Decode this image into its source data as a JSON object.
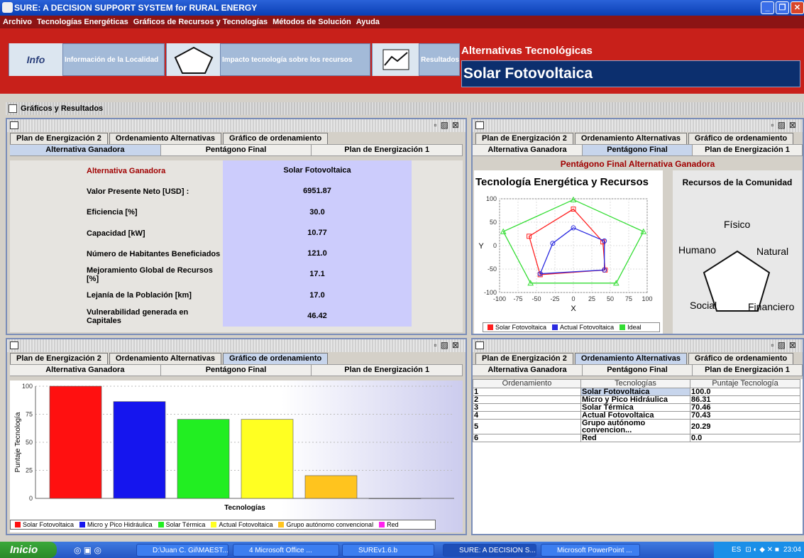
{
  "window": {
    "title": "SURE: A DECISION SUPPORT SYSTEM for RURAL ENERGY"
  },
  "menu": [
    "Archivo",
    "Tecnologías Energéticas",
    "Gráficos de Recursos y Tecnologías",
    "Métodos de Solución",
    "Ayuda"
  ],
  "toolbar": {
    "info_icon_text": "Info",
    "info_label": "Información de la Localidad",
    "impact_label": "Impacto tecnología sobre los recursos",
    "results_label": "Resultados",
    "alt_title": "Alternativas Tecnológicas",
    "alt_value": "Solar Fotovoltaica"
  },
  "section": {
    "title": "Gráficos y Resultados"
  },
  "tabs_top": [
    "Plan de Energización 2",
    "Ordenamiento Alternativas",
    "Gráfico de ordenamiento"
  ],
  "tabs_bottom": [
    "Alternativa Ganadora",
    "Pentágono Final",
    "Plan de Energización 1"
  ],
  "winner": {
    "rows": [
      {
        "label": "Alternativa Ganadora",
        "value": "Solar Fotovoltaica"
      },
      {
        "label": "Valor Presente Neto [USD] :",
        "value": "6951.87"
      },
      {
        "label": "Eficiencia [%]",
        "value": "30.0"
      },
      {
        "label": "Capacidad [kW]",
        "value": "10.77"
      },
      {
        "label": "Número de Habitantes Beneficiados",
        "value": "121.0"
      },
      {
        "label": "Mejoramiento Global de Recursos [%]",
        "value": "17.1"
      },
      {
        "label": "Lejanía de la Población [km]",
        "value": "17.0"
      },
      {
        "label": "Vulnerabilidad generada en Capitales",
        "value": "46.42"
      }
    ]
  },
  "pentagon": {
    "header": "Pentágono Final Alternativa Ganadora",
    "chart_title": "Tecnología Energética y Recursos",
    "community_title": "Recursos de la Comunidad",
    "community_labels": [
      "Físico",
      "Humano",
      "Natural",
      "Social",
      "Financiero"
    ]
  },
  "ranking": {
    "columns": [
      "Ordenamiento",
      "Tecnologías",
      "Puntaje Tecnología"
    ],
    "rows": [
      [
        "1",
        "Solar Fotovoltaica",
        "100.0"
      ],
      [
        "2",
        "Micro y Pico Hidráulica",
        "86.31"
      ],
      [
        "3",
        "Solar Térmica",
        "70.46"
      ],
      [
        "4",
        "Actual Fotovoltaica",
        "70.43"
      ],
      [
        "5",
        "Grupo autónomo convencion...",
        "20.29"
      ],
      [
        "6",
        "Red",
        "0.0"
      ]
    ]
  },
  "chart_data": [
    {
      "type": "scatter",
      "title": "Tecnología Energética y Recursos",
      "xlabel": "X",
      "ylabel": "Y",
      "xlim": [
        -100,
        100
      ],
      "ylim": [
        -100,
        100
      ],
      "xticks": [
        "-100",
        "-75",
        "-50",
        "-25",
        "0",
        "25",
        "50",
        "75",
        "100"
      ],
      "yticks": [
        "100",
        "50",
        "0",
        "-50",
        "-100"
      ],
      "legend_position": "bottom",
      "series": [
        {
          "name": "Solar Fotovoltaica",
          "color": "#ff2020",
          "points": [
            [
              0,
              78
            ],
            [
              40,
              8
            ],
            [
              43,
              -52
            ],
            [
              -45,
              -62
            ],
            [
              -60,
              20
            ]
          ]
        },
        {
          "name": "Actual Fotovoltaica",
          "color": "#2a2ae0",
          "points": [
            [
              0,
              38
            ],
            [
              42,
              10
            ],
            [
              42,
              -52
            ],
            [
              -45,
              -60
            ],
            [
              -28,
              5
            ]
          ]
        },
        {
          "name": "Ideal",
          "color": "#33dd33",
          "points": [
            [
              0,
              98
            ],
            [
              95,
              30
            ],
            [
              58,
              -80
            ],
            [
              -58,
              -80
            ],
            [
              -95,
              30
            ]
          ]
        }
      ]
    },
    {
      "type": "bar",
      "xlabel": "Tecnologías",
      "ylabel": "Puntaje Tecnología",
      "ylim": [
        0,
        100
      ],
      "yticks": [
        "100",
        "75",
        "50",
        "25",
        "0"
      ],
      "legend_position": "bottom",
      "categories": [
        "Solar Fotovoltaica",
        "Micro y Pico Hidráulica",
        "Solar Térmica",
        "Actual Fotovoltaica",
        "Grupo autónomo convencional",
        "Red"
      ],
      "values": [
        100.0,
        86.31,
        70.46,
        70.43,
        20.29,
        0.0
      ],
      "colors": [
        "#ff1010",
        "#1515ee",
        "#22ee22",
        "#ffff22",
        "#ffc41e",
        "#ff22ee"
      ]
    }
  ],
  "taskbar": {
    "start": "Inicio",
    "items": [
      "D:\\Juan C. Gil\\MAEST...",
      "4 Microsoft Office ...",
      "SUREv1.6.b",
      "SURE: A DECISION S...",
      "Microsoft PowerPoint ..."
    ],
    "lang": "ES",
    "time": "23:04"
  }
}
